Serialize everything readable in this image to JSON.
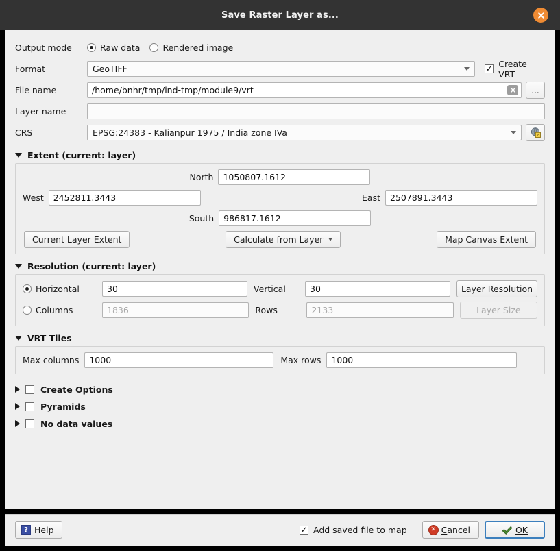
{
  "window": {
    "title": "Save Raster Layer as...",
    "close_icon": "close-circle-icon"
  },
  "form": {
    "output_mode": {
      "label": "Output mode",
      "options": [
        "Raw data",
        "Rendered image"
      ],
      "selected": "Raw data"
    },
    "format": {
      "label": "Format",
      "value": "GeoTIFF"
    },
    "create_vrt": {
      "label": "Create VRT",
      "checked": true
    },
    "file_name": {
      "label": "File name",
      "value": "/home/bnhr/tmp/ind-tmp/module9/vrt",
      "clear_icon": "clear-x-icon",
      "browse_label": "..."
    },
    "layer_name": {
      "label": "Layer name",
      "value": "",
      "placeholder": ""
    },
    "crs": {
      "label": "CRS",
      "value": "EPSG:24383 - Kalianpur 1975 / India zone IVa",
      "select_icon": "crs-globe-icon"
    }
  },
  "extent": {
    "title": "Extent (current: layer)",
    "north_label": "North",
    "north_value": "1050807.1612",
    "west_label": "West",
    "west_value": "2452811.3443",
    "east_label": "East",
    "east_value": "2507891.3443",
    "south_label": "South",
    "south_value": "986817.1612",
    "buttons": {
      "current_layer_extent": "Current Layer Extent",
      "calculate_from_layer": "Calculate from Layer",
      "map_canvas_extent": "Map Canvas Extent"
    }
  },
  "resolution": {
    "title": "Resolution (current: layer)",
    "horizontal_label": "Horizontal",
    "horizontal_value": "30",
    "horizontal_selected": true,
    "vertical_label": "Vertical",
    "vertical_value": "30",
    "layer_resolution_button": "Layer Resolution",
    "columns_label": "Columns",
    "columns_value": "1836",
    "columns_selected": false,
    "rows_label": "Rows",
    "rows_value": "2133",
    "layer_size_button": "Layer Size"
  },
  "vrt_tiles": {
    "title": "VRT Tiles",
    "max_columns_label": "Max columns",
    "max_columns_value": "1000",
    "max_rows_label": "Max rows",
    "max_rows_value": "1000"
  },
  "collapsed_sections": [
    {
      "label": "Create Options",
      "checked": false
    },
    {
      "label": "Pyramids",
      "checked": false
    },
    {
      "label": "No data values",
      "checked": false
    }
  ],
  "footer": {
    "help_label": "Help",
    "help_icon": "question-mark-icon",
    "add_saved_file_label": "Add saved file to map",
    "add_saved_file_checked": true,
    "cancel_label": "Cancel",
    "cancel_icon": "stop-circle-icon",
    "ok_label": "OK",
    "ok_icon": "green-arrow-icon"
  },
  "colors": {
    "titlebar_bg": "#333333",
    "dialog_bg": "#efefef",
    "close_orange": "#ef8b33",
    "focus_blue": "#3c7fbd",
    "cancel_red": "#cf3b25",
    "help_blue": "#3b4fa4"
  }
}
